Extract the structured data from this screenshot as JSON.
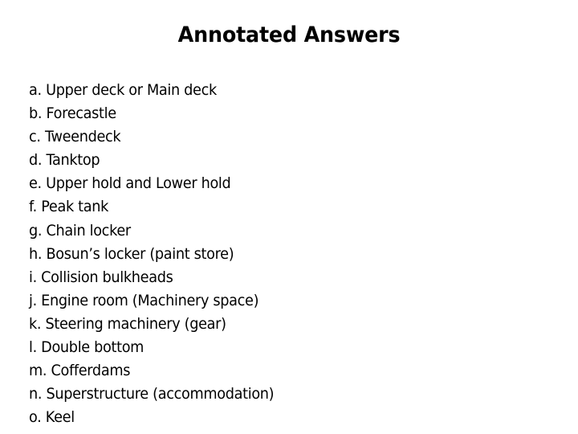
{
  "slide": {
    "title": "Annotated Answers",
    "background_color": "#ffffff",
    "text_color": "#000000",
    "answers": [
      {
        "label": "a. Upper deck or Main deck"
      },
      {
        "label": "b. Forecastle"
      },
      {
        "label": "c. Tweendeck"
      },
      {
        "label": "d. Tanktop"
      },
      {
        "label": "e. Upper hold and Lower hold"
      },
      {
        "label": "f. Peak tank"
      },
      {
        "label": "g. Chain locker"
      },
      {
        "label": "h. Bosun’s locker (paint store)"
      },
      {
        "label": "i. Collision bulkheads"
      },
      {
        "label": "j. Engine room (Machinery space)"
      },
      {
        "label": "k. Steering machinery (gear)"
      },
      {
        "label": "l. Double bottom"
      },
      {
        "label": "m. Cofferdams"
      },
      {
        "label": "n. Superstructure (accommodation)"
      },
      {
        "label": "o. Keel"
      }
    ]
  }
}
